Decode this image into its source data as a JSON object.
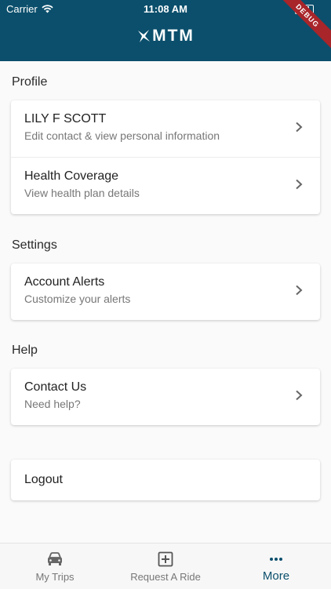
{
  "status_bar": {
    "carrier": "Carrier",
    "time": "11:08 AM"
  },
  "debug_label": "DEBUG",
  "logo": {
    "text": "MTM"
  },
  "sections": {
    "profile": {
      "title": "Profile",
      "items": [
        {
          "title": "LILY F SCOTT",
          "subtitle": "Edit contact & view personal information"
        },
        {
          "title": "Health Coverage",
          "subtitle": "View health plan details"
        }
      ]
    },
    "settings": {
      "title": "Settings",
      "items": [
        {
          "title": "Account Alerts",
          "subtitle": "Customize your alerts"
        }
      ]
    },
    "help": {
      "title": "Help",
      "items": [
        {
          "title": "Contact Us",
          "subtitle": "Need help?"
        }
      ]
    }
  },
  "logout_label": "Logout",
  "tabs": [
    {
      "label": "My Trips",
      "icon": "car-icon"
    },
    {
      "label": "Request A Ride",
      "icon": "plus-square-icon"
    },
    {
      "label": "More",
      "icon": "more-dots-icon",
      "active": true
    }
  ],
  "colors": {
    "header": "#0b4f6c",
    "accent": "#0b4f6c",
    "debug": "#a8252a"
  }
}
